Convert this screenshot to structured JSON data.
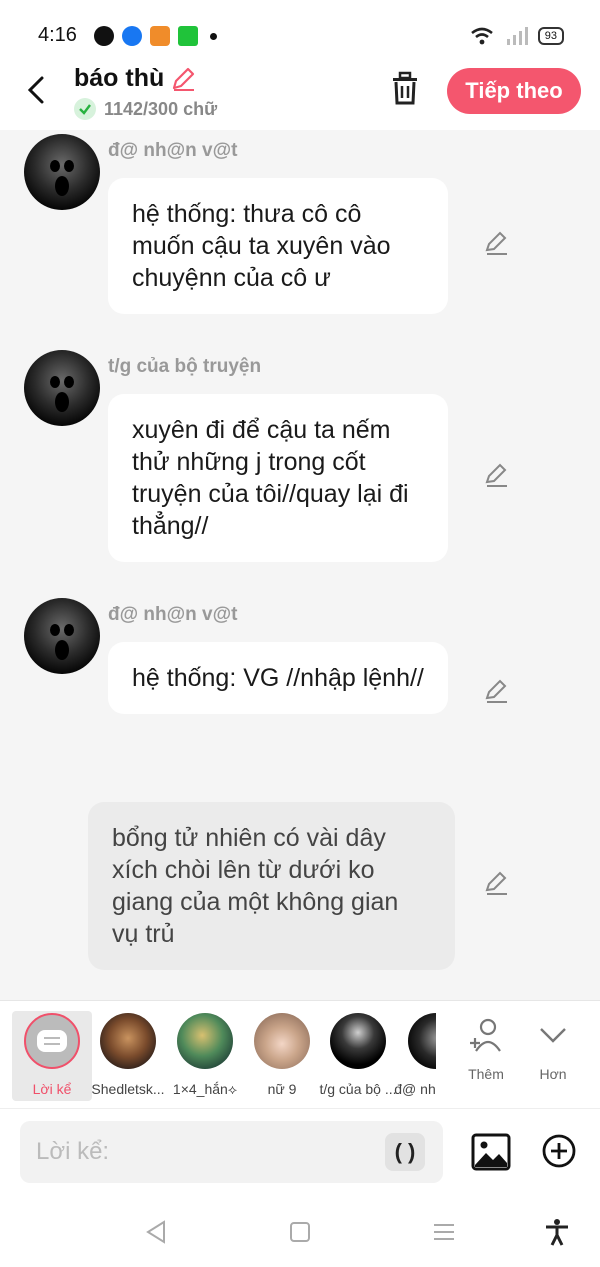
{
  "status": {
    "time": "4:16",
    "battery": "93"
  },
  "header": {
    "title": "báo thù",
    "word_count": "1142/300 chữ",
    "next_label": "Tiếp theo"
  },
  "messages": [
    {
      "speaker": "đ@ nh@n v@t",
      "text": "hệ thống: thưa cô cô muốn cậu ta xuyên vào chuyệnn của cô ư"
    },
    {
      "speaker": "t/g của bộ truyện",
      "text": "xuyên đi để cậu ta nếm thử những j trong cốt truyện của tôi//quay lại đi thẳng//"
    },
    {
      "speaker": "đ@ nh@n v@t",
      "text": "hệ thống: VG //nhập lệnh//"
    },
    {
      "speaker": "",
      "text": "bổng tử nhiên có vài dây xích chòi lên từ dưới ko giang của một không gian vụ trủ"
    }
  ],
  "characters": [
    {
      "label": "Lời kể"
    },
    {
      "label": "Shedletsk..."
    },
    {
      "label": "1×4_hắn⟡"
    },
    {
      "label": "nữ 9"
    },
    {
      "label": "t/g của bộ ..."
    },
    {
      "label": "đ@ nh"
    }
  ],
  "tools": {
    "more_label": "Thêm",
    "expand_label": "Hơn"
  },
  "input": {
    "placeholder": "Lời kể:",
    "paren": "( )"
  },
  "colors": {
    "accent": "#f4566e",
    "bubble": "#ffffff",
    "narration": "#ebebeb"
  }
}
